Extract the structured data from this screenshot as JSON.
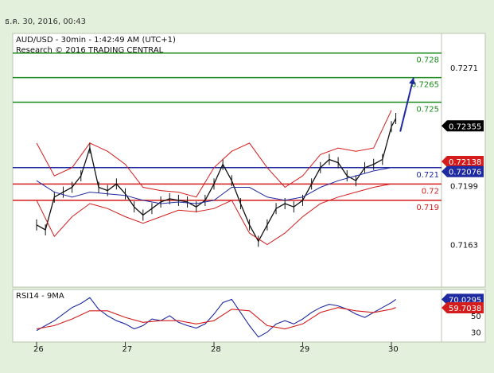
{
  "header": {
    "timestamp": "ธ.ค. 30, 2016, 00:43"
  },
  "chart_data": [
    {
      "type": "line",
      "title": "AUD/USD - 30min - 1:42:49 AM (UTC+1)",
      "subtitle": "Research © 2016 TRADING CENTRAL",
      "x_ticks": [
        "26",
        "27",
        "28",
        "29",
        "30"
      ],
      "y_ticks": [
        0.7271,
        0.7199,
        0.7163
      ],
      "ylim": [
        0.7137,
        0.7292
      ],
      "grid": false,
      "levels": [
        {
          "label": "0.728",
          "value": 0.728,
          "color": "#1a8a1a"
        },
        {
          "label": "0.7265",
          "value": 0.7265,
          "color": "#1a8a1a"
        },
        {
          "label": "0.725",
          "value": 0.725,
          "color": "#1a8a1a"
        },
        {
          "label": "0.721",
          "value": 0.721,
          "color": "#1e2aa0"
        },
        {
          "label": "0.72",
          "value": 0.72,
          "color": "#d41c1c"
        },
        {
          "label": "0.719",
          "value": 0.719,
          "color": "#d41c1c"
        }
      ],
      "price_tags": [
        {
          "label": "0.72355",
          "value": 0.72355,
          "bg": "#000000"
        },
        {
          "label": "0.72138",
          "value": 0.72138,
          "bg": "#d41c1c"
        },
        {
          "label": "0.72076",
          "value": 0.72076,
          "bg": "#1e2aa0"
        }
      ],
      "forecast_arrow": {
        "from_x": 4.1,
        "from_y": 0.7232,
        "to_x": 4.25,
        "to_y": 0.7265,
        "color": "#1e2aa0"
      },
      "series": [
        {
          "name": "price",
          "x": [
            0.0,
            0.1,
            0.2,
            0.3,
            0.4,
            0.5,
            0.6,
            0.7,
            0.8,
            0.9,
            1.0,
            1.1,
            1.2,
            1.3,
            1.4,
            1.5,
            1.6,
            1.7,
            1.8,
            1.9,
            2.0,
            2.1,
            2.2,
            2.3,
            2.4,
            2.5,
            2.6,
            2.7,
            2.8,
            2.9,
            3.0,
            3.1,
            3.2,
            3.3,
            3.4,
            3.5,
            3.6,
            3.7,
            3.8,
            3.9,
            4.0,
            4.05
          ],
          "values": [
            0.7175,
            0.7172,
            0.7192,
            0.7195,
            0.7198,
            0.7205,
            0.7222,
            0.7198,
            0.7196,
            0.72,
            0.7194,
            0.7186,
            0.7181,
            0.7185,
            0.7189,
            0.7191,
            0.719,
            0.7189,
            0.7186,
            0.719,
            0.72,
            0.7212,
            0.7202,
            0.7188,
            0.7175,
            0.7165,
            0.7175,
            0.7185,
            0.7188,
            0.7186,
            0.719,
            0.72,
            0.721,
            0.7215,
            0.7213,
            0.7205,
            0.7202,
            0.721,
            0.7212,
            0.7215,
            0.7235,
            0.724
          ]
        },
        {
          "name": "upper band",
          "x": [
            0.0,
            0.2,
            0.4,
            0.6,
            0.8,
            1.0,
            1.2,
            1.4,
            1.6,
            1.8,
            2.0,
            2.2,
            2.4,
            2.6,
            2.8,
            3.0,
            3.2,
            3.4,
            3.6,
            3.8,
            4.0
          ],
          "values": [
            0.7225,
            0.7205,
            0.721,
            0.7225,
            0.722,
            0.7212,
            0.7198,
            0.7196,
            0.7195,
            0.7192,
            0.721,
            0.722,
            0.7225,
            0.721,
            0.7198,
            0.7205,
            0.7218,
            0.7222,
            0.722,
            0.7222,
            0.7245
          ]
        },
        {
          "name": "lower band",
          "x": [
            0.0,
            0.2,
            0.4,
            0.6,
            0.8,
            1.0,
            1.2,
            1.4,
            1.6,
            1.8,
            2.0,
            2.2,
            2.4,
            2.6,
            2.8,
            3.0,
            3.2,
            3.4,
            3.6,
            3.8,
            4.0
          ],
          "values": [
            0.719,
            0.7168,
            0.718,
            0.7188,
            0.7185,
            0.718,
            0.7176,
            0.718,
            0.7184,
            0.7183,
            0.7185,
            0.719,
            0.717,
            0.7163,
            0.717,
            0.718,
            0.7188,
            0.7192,
            0.7195,
            0.7198,
            0.72
          ]
        },
        {
          "name": "moving average",
          "x": [
            0.0,
            0.2,
            0.4,
            0.6,
            0.8,
            1.0,
            1.2,
            1.4,
            1.6,
            1.8,
            2.0,
            2.2,
            2.4,
            2.6,
            2.8,
            3.0,
            3.2,
            3.4,
            3.6,
            3.8,
            4.0
          ],
          "values": [
            0.7202,
            0.7195,
            0.7192,
            0.7195,
            0.7194,
            0.7193,
            0.719,
            0.7188,
            0.7189,
            0.7188,
            0.719,
            0.7198,
            0.7198,
            0.7192,
            0.719,
            0.7192,
            0.7198,
            0.7202,
            0.7205,
            0.7208,
            0.721
          ]
        }
      ]
    },
    {
      "type": "line",
      "title": "RSI14 - 9MA",
      "y_ticks": [
        50,
        30
      ],
      "ylim": [
        18,
        82
      ],
      "price_tags": [
        {
          "label": "70.0295",
          "value": 70.0295,
          "bg": "#1e2aa0"
        },
        {
          "label": "59.7038",
          "value": 59.7038,
          "bg": "#d41c1c"
        }
      ],
      "series": [
        {
          "name": "RSI14",
          "color": "#1e2aa0",
          "x": [
            0.0,
            0.1,
            0.2,
            0.3,
            0.4,
            0.5,
            0.6,
            0.7,
            0.8,
            0.9,
            1.0,
            1.1,
            1.2,
            1.3,
            1.4,
            1.5,
            1.6,
            1.7,
            1.8,
            1.9,
            2.0,
            2.1,
            2.2,
            2.3,
            2.4,
            2.5,
            2.6,
            2.7,
            2.8,
            2.9,
            3.0,
            3.1,
            3.2,
            3.3,
            3.4,
            3.5,
            3.6,
            3.7,
            3.8,
            3.9,
            4.0,
            4.05
          ],
          "values": [
            32,
            38,
            44,
            52,
            60,
            65,
            72,
            58,
            50,
            44,
            40,
            34,
            38,
            46,
            44,
            50,
            42,
            38,
            35,
            40,
            52,
            66,
            70,
            54,
            38,
            24,
            30,
            40,
            44,
            40,
            46,
            54,
            60,
            64,
            62,
            58,
            52,
            48,
            54,
            60,
            66,
            70
          ]
        },
        {
          "name": "9MA",
          "color": "#d41c1c",
          "x": [
            0.0,
            0.2,
            0.4,
            0.6,
            0.8,
            1.0,
            1.2,
            1.4,
            1.6,
            1.8,
            2.0,
            2.2,
            2.4,
            2.6,
            2.8,
            3.0,
            3.2,
            3.4,
            3.6,
            3.8,
            4.0,
            4.05
          ],
          "values": [
            34,
            38,
            46,
            56,
            56,
            48,
            42,
            44,
            44,
            40,
            44,
            58,
            56,
            38,
            34,
            40,
            54,
            60,
            56,
            54,
            58,
            60
          ]
        }
      ]
    }
  ]
}
